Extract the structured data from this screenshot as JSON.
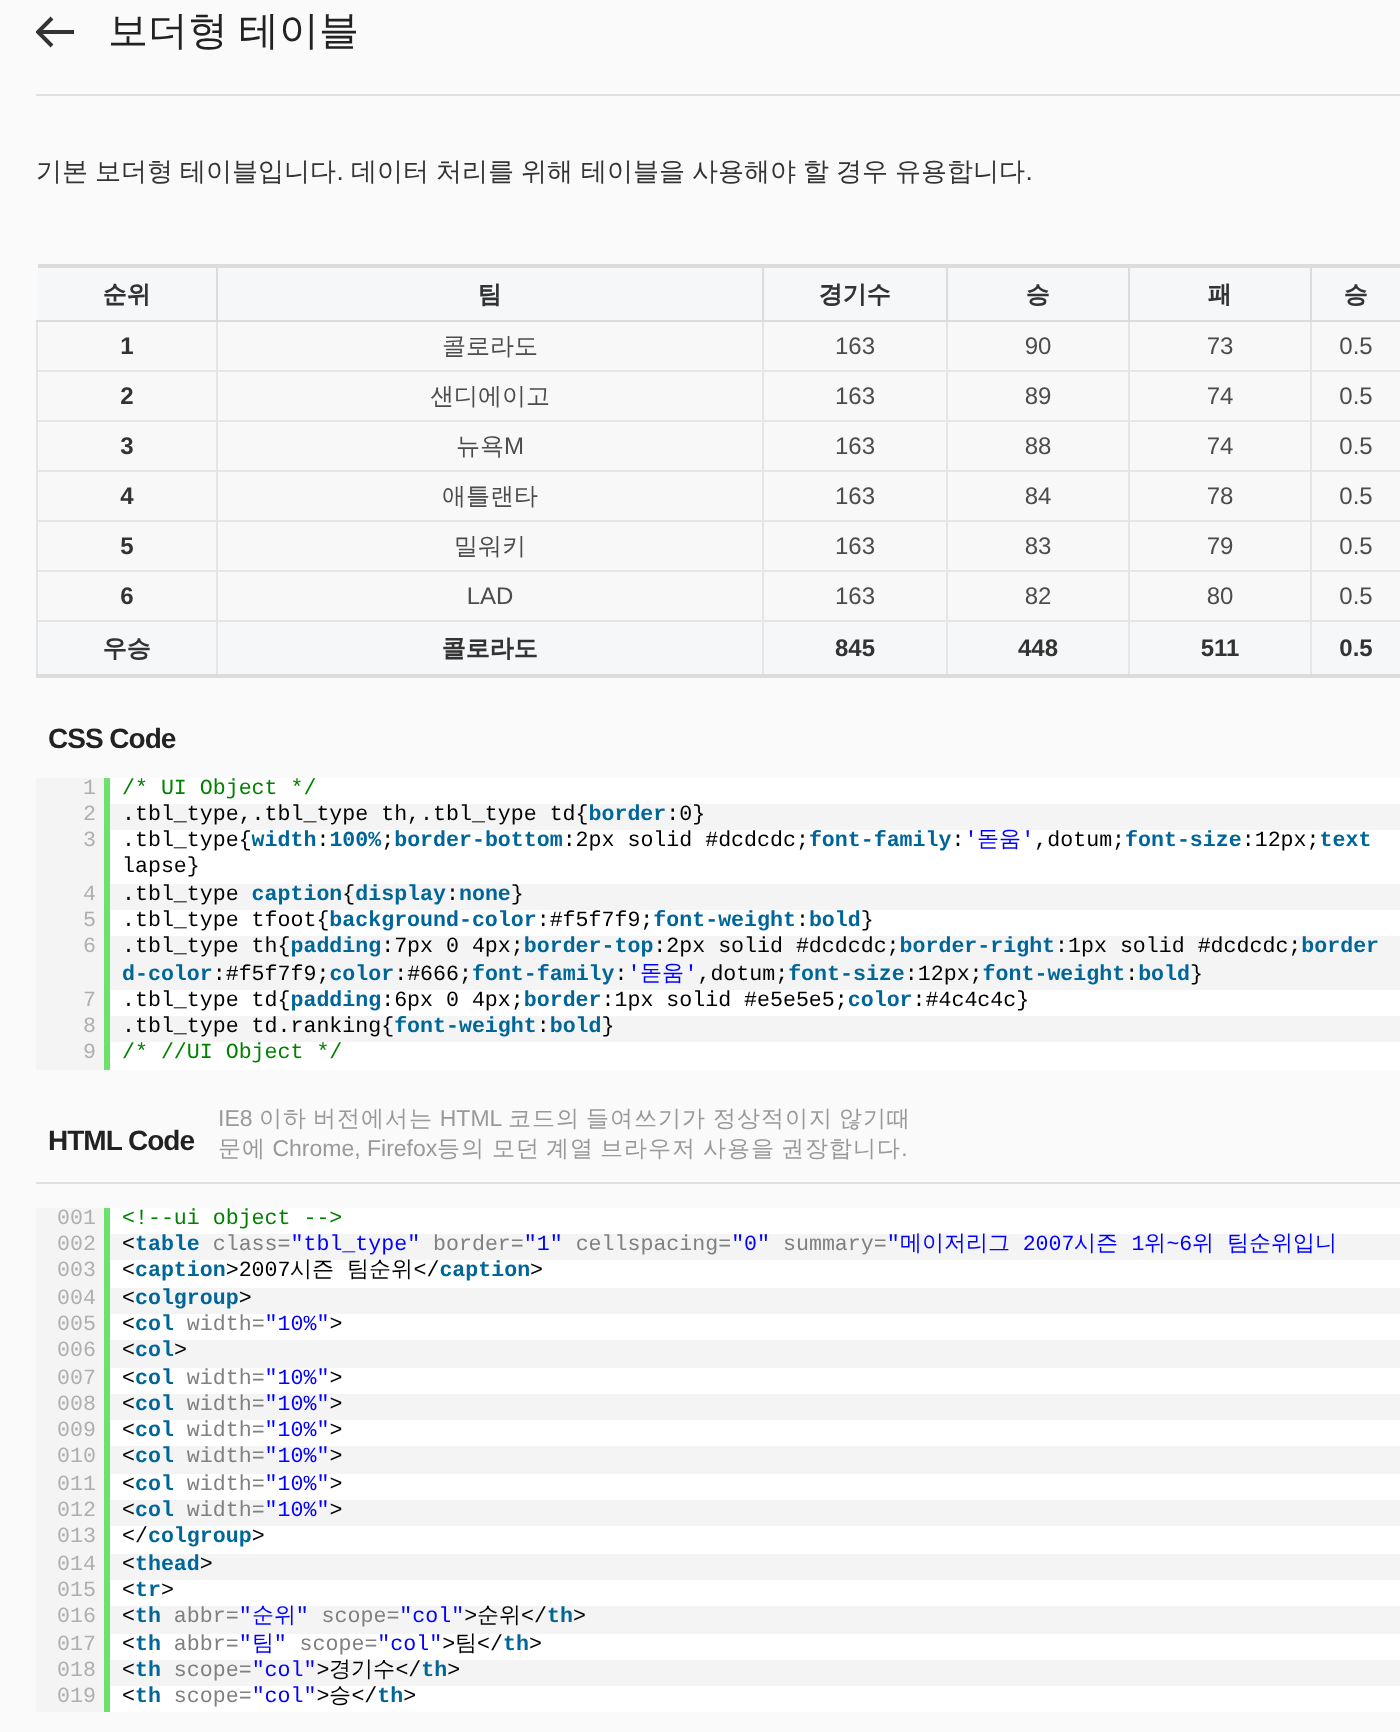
{
  "header": {
    "title": "보더형 테이블"
  },
  "description": "기본 보더형 테이블입니다. 데이터 처리를 위해 테이블을 사용해야 할 경우 유용합니다.",
  "table": {
    "columns": [
      "순위",
      "팀",
      "경기수",
      "승",
      "패",
      "승"
    ],
    "rows": [
      [
        "1",
        "콜로라도",
        "163",
        "90",
        "73",
        "0.5"
      ],
      [
        "2",
        "샌디에이고",
        "163",
        "89",
        "74",
        "0.5"
      ],
      [
        "3",
        "뉴욕M",
        "163",
        "88",
        "74",
        "0.5"
      ],
      [
        "4",
        "애틀랜타",
        "163",
        "84",
        "78",
        "0.5"
      ],
      [
        "5",
        "밀워키",
        "163",
        "83",
        "79",
        "0.5"
      ],
      [
        "6",
        "LAD",
        "163",
        "82",
        "80",
        "0.5"
      ]
    ],
    "footer": [
      "우승",
      "콜로라도",
      "845",
      "448",
      "511",
      "0.5"
    ]
  },
  "css_code": {
    "heading": "CSS Code",
    "lines": [
      {
        "number": "1",
        "parts": [
          [
            {
              "kind": "c",
              "text": "/* UI Object */"
            }
          ]
        ]
      },
      {
        "number": "2",
        "parts": [
          [
            {
              "kind": "p",
              "text": ".tbl_type,.tbl_type th,.tbl_type td{"
            },
            {
              "kind": "k",
              "text": "border"
            },
            {
              "kind": "p",
              "text": ":0}"
            }
          ]
        ]
      },
      {
        "number": "3",
        "parts": [
          [
            {
              "kind": "p",
              "text": ".tbl_type{"
            },
            {
              "kind": "k",
              "text": "width"
            },
            {
              "kind": "p",
              "text": ":"
            },
            {
              "kind": "k",
              "text": "100%"
            },
            {
              "kind": "p",
              "text": ";"
            },
            {
              "kind": "k",
              "text": "border-bottom"
            },
            {
              "kind": "p",
              "text": ":2px solid #dcdcdc;"
            },
            {
              "kind": "k",
              "text": "font-family"
            },
            {
              "kind": "p",
              "text": ":"
            },
            {
              "kind": "s",
              "text": "'돋움'"
            },
            {
              "kind": "p",
              "text": ",dotum;"
            },
            {
              "kind": "k",
              "text": "font-size"
            },
            {
              "kind": "p",
              "text": ":12px;"
            },
            {
              "kind": "k",
              "text": "text"
            }
          ],
          [
            {
              "kind": "p",
              "text": "lapse}"
            }
          ]
        ]
      },
      {
        "number": "4",
        "parts": [
          [
            {
              "kind": "p",
              "text": ".tbl_type "
            },
            {
              "kind": "k",
              "text": "caption"
            },
            {
              "kind": "p",
              "text": "{"
            },
            {
              "kind": "k",
              "text": "display"
            },
            {
              "kind": "p",
              "text": ":"
            },
            {
              "kind": "k",
              "text": "none"
            },
            {
              "kind": "p",
              "text": "}"
            }
          ]
        ]
      },
      {
        "number": "5",
        "parts": [
          [
            {
              "kind": "p",
              "text": ".tbl_type tfoot{"
            },
            {
              "kind": "k",
              "text": "background-color"
            },
            {
              "kind": "p",
              "text": ":#f5f7f9;"
            },
            {
              "kind": "k",
              "text": "font-weight"
            },
            {
              "kind": "p",
              "text": ":"
            },
            {
              "kind": "k",
              "text": "bold"
            },
            {
              "kind": "p",
              "text": "}"
            }
          ]
        ]
      },
      {
        "number": "6",
        "parts": [
          [
            {
              "kind": "p",
              "text": ".tbl_type th{"
            },
            {
              "kind": "k",
              "text": "padding"
            },
            {
              "kind": "p",
              "text": ":7px 0 4px;"
            },
            {
              "kind": "k",
              "text": "border-top"
            },
            {
              "kind": "p",
              "text": ":2px solid #dcdcdc;"
            },
            {
              "kind": "k",
              "text": "border-right"
            },
            {
              "kind": "p",
              "text": ":1px solid #dcdcdc;"
            },
            {
              "kind": "k",
              "text": "border"
            }
          ],
          [
            {
              "kind": "k",
              "text": "d-color"
            },
            {
              "kind": "p",
              "text": ":#f5f7f9;"
            },
            {
              "kind": "k",
              "text": "color"
            },
            {
              "kind": "p",
              "text": ":#666;"
            },
            {
              "kind": "k",
              "text": "font-family"
            },
            {
              "kind": "p",
              "text": ":"
            },
            {
              "kind": "s",
              "text": "'돋움'"
            },
            {
              "kind": "p",
              "text": ",dotum;"
            },
            {
              "kind": "k",
              "text": "font-size"
            },
            {
              "kind": "p",
              "text": ":12px;"
            },
            {
              "kind": "k",
              "text": "font-weight"
            },
            {
              "kind": "p",
              "text": ":"
            },
            {
              "kind": "k",
              "text": "bold"
            },
            {
              "kind": "p",
              "text": "}"
            }
          ]
        ]
      },
      {
        "number": "7",
        "parts": [
          [
            {
              "kind": "p",
              "text": ".tbl_type td{"
            },
            {
              "kind": "k",
              "text": "padding"
            },
            {
              "kind": "p",
              "text": ":6px 0 4px;"
            },
            {
              "kind": "k",
              "text": "border"
            },
            {
              "kind": "p",
              "text": ":1px solid #e5e5e5;"
            },
            {
              "kind": "k",
              "text": "color"
            },
            {
              "kind": "p",
              "text": ":#4c4c4c}"
            }
          ]
        ]
      },
      {
        "number": "8",
        "parts": [
          [
            {
              "kind": "p",
              "text": ".tbl_type td.ranking{"
            },
            {
              "kind": "k",
              "text": "font-weight"
            },
            {
              "kind": "p",
              "text": ":"
            },
            {
              "kind": "k",
              "text": "bold"
            },
            {
              "kind": "p",
              "text": "}"
            }
          ]
        ]
      },
      {
        "number": "9",
        "parts": [
          [
            {
              "kind": "c",
              "text": "/* //UI Object */"
            }
          ]
        ]
      }
    ]
  },
  "html_code": {
    "heading": "HTML Code",
    "note": "IE8 이하 버전에서는 HTML 코드의 들여쓰기가 정상적이지 않기때문에 Chrome, Firefox등의 모던 계열 브라우저 사용을 권장합니다.",
    "lines": [
      {
        "number": "001",
        "parts": [
          [
            {
              "kind": "c",
              "text": "<!--ui object -->"
            }
          ]
        ]
      },
      {
        "number": "002",
        "parts": [
          [
            {
              "kind": "p",
              "text": "<"
            },
            {
              "kind": "k",
              "text": "table"
            },
            {
              "kind": "a",
              "text": " class="
            },
            {
              "kind": "s",
              "text": "\"tbl_type\""
            },
            {
              "kind": "a",
              "text": " border="
            },
            {
              "kind": "s",
              "text": "\"1\""
            },
            {
              "kind": "a",
              "text": " cellspacing="
            },
            {
              "kind": "s",
              "text": "\"0\""
            },
            {
              "kind": "a",
              "text": " summary="
            },
            {
              "kind": "s",
              "text": "\"메이저리그 2007시즌 1위~6위 팀순위입니"
            }
          ]
        ]
      },
      {
        "number": "003",
        "parts": [
          [
            {
              "kind": "p",
              "text": "<"
            },
            {
              "kind": "k",
              "text": "caption"
            },
            {
              "kind": "p",
              "text": ">2007시즌 팀순위</"
            },
            {
              "kind": "k",
              "text": "caption"
            },
            {
              "kind": "p",
              "text": ">"
            }
          ]
        ]
      },
      {
        "number": "004",
        "parts": [
          [
            {
              "kind": "p",
              "text": "<"
            },
            {
              "kind": "k",
              "text": "colgroup"
            },
            {
              "kind": "p",
              "text": ">"
            }
          ]
        ]
      },
      {
        "number": "005",
        "parts": [
          [
            {
              "kind": "p",
              "text": "<"
            },
            {
              "kind": "k",
              "text": "col"
            },
            {
              "kind": "a",
              "text": " width="
            },
            {
              "kind": "s",
              "text": "\"10%\""
            },
            {
              "kind": "p",
              "text": ">"
            }
          ]
        ]
      },
      {
        "number": "006",
        "parts": [
          [
            {
              "kind": "p",
              "text": "<"
            },
            {
              "kind": "k",
              "text": "col"
            },
            {
              "kind": "p",
              "text": ">"
            }
          ]
        ]
      },
      {
        "number": "007",
        "parts": [
          [
            {
              "kind": "p",
              "text": "<"
            },
            {
              "kind": "k",
              "text": "col"
            },
            {
              "kind": "a",
              "text": " width="
            },
            {
              "kind": "s",
              "text": "\"10%\""
            },
            {
              "kind": "p",
              "text": ">"
            }
          ]
        ]
      },
      {
        "number": "008",
        "parts": [
          [
            {
              "kind": "p",
              "text": "<"
            },
            {
              "kind": "k",
              "text": "col"
            },
            {
              "kind": "a",
              "text": " width="
            },
            {
              "kind": "s",
              "text": "\"10%\""
            },
            {
              "kind": "p",
              "text": ">"
            }
          ]
        ]
      },
      {
        "number": "009",
        "parts": [
          [
            {
              "kind": "p",
              "text": "<"
            },
            {
              "kind": "k",
              "text": "col"
            },
            {
              "kind": "a",
              "text": " width="
            },
            {
              "kind": "s",
              "text": "\"10%\""
            },
            {
              "kind": "p",
              "text": ">"
            }
          ]
        ]
      },
      {
        "number": "010",
        "parts": [
          [
            {
              "kind": "p",
              "text": "<"
            },
            {
              "kind": "k",
              "text": "col"
            },
            {
              "kind": "a",
              "text": " width="
            },
            {
              "kind": "s",
              "text": "\"10%\""
            },
            {
              "kind": "p",
              "text": ">"
            }
          ]
        ]
      },
      {
        "number": "011",
        "parts": [
          [
            {
              "kind": "p",
              "text": "<"
            },
            {
              "kind": "k",
              "text": "col"
            },
            {
              "kind": "a",
              "text": " width="
            },
            {
              "kind": "s",
              "text": "\"10%\""
            },
            {
              "kind": "p",
              "text": ">"
            }
          ]
        ]
      },
      {
        "number": "012",
        "parts": [
          [
            {
              "kind": "p",
              "text": "<"
            },
            {
              "kind": "k",
              "text": "col"
            },
            {
              "kind": "a",
              "text": " width="
            },
            {
              "kind": "s",
              "text": "\"10%\""
            },
            {
              "kind": "p",
              "text": ">"
            }
          ]
        ]
      },
      {
        "number": "013",
        "parts": [
          [
            {
              "kind": "p",
              "text": "</"
            },
            {
              "kind": "k",
              "text": "colgroup"
            },
            {
              "kind": "p",
              "text": ">"
            }
          ]
        ]
      },
      {
        "number": "014",
        "parts": [
          [
            {
              "kind": "p",
              "text": "<"
            },
            {
              "kind": "k",
              "text": "thead"
            },
            {
              "kind": "p",
              "text": ">"
            }
          ]
        ]
      },
      {
        "number": "015",
        "parts": [
          [
            {
              "kind": "p",
              "text": "<"
            },
            {
              "kind": "k",
              "text": "tr"
            },
            {
              "kind": "p",
              "text": ">"
            }
          ]
        ]
      },
      {
        "number": "016",
        "parts": [
          [
            {
              "kind": "p",
              "text": "<"
            },
            {
              "kind": "k",
              "text": "th"
            },
            {
              "kind": "a",
              "text": " abbr="
            },
            {
              "kind": "s",
              "text": "\"순위\""
            },
            {
              "kind": "a",
              "text": " scope="
            },
            {
              "kind": "s",
              "text": "\"col\""
            },
            {
              "kind": "p",
              "text": ">순위</"
            },
            {
              "kind": "k",
              "text": "th"
            },
            {
              "kind": "p",
              "text": ">"
            }
          ]
        ]
      },
      {
        "number": "017",
        "parts": [
          [
            {
              "kind": "p",
              "text": "<"
            },
            {
              "kind": "k",
              "text": "th"
            },
            {
              "kind": "a",
              "text": " abbr="
            },
            {
              "kind": "s",
              "text": "\"팀\""
            },
            {
              "kind": "a",
              "text": " scope="
            },
            {
              "kind": "s",
              "text": "\"col\""
            },
            {
              "kind": "p",
              "text": ">팀</"
            },
            {
              "kind": "k",
              "text": "th"
            },
            {
              "kind": "p",
              "text": ">"
            }
          ]
        ]
      },
      {
        "number": "018",
        "parts": [
          [
            {
              "kind": "p",
              "text": "<"
            },
            {
              "kind": "k",
              "text": "th"
            },
            {
              "kind": "a",
              "text": " scope="
            },
            {
              "kind": "s",
              "text": "\"col\""
            },
            {
              "kind": "p",
              "text": ">경기수</"
            },
            {
              "kind": "k",
              "text": "th"
            },
            {
              "kind": "p",
              "text": ">"
            }
          ]
        ]
      },
      {
        "number": "019",
        "parts": [
          [
            {
              "kind": "p",
              "text": "<"
            },
            {
              "kind": "k",
              "text": "th"
            },
            {
              "kind": "a",
              "text": " scope="
            },
            {
              "kind": "s",
              "text": "\"col\""
            },
            {
              "kind": "p",
              "text": ">승</"
            },
            {
              "kind": "k",
              "text": "th"
            },
            {
              "kind": "p",
              "text": ">"
            }
          ]
        ]
      }
    ]
  }
}
